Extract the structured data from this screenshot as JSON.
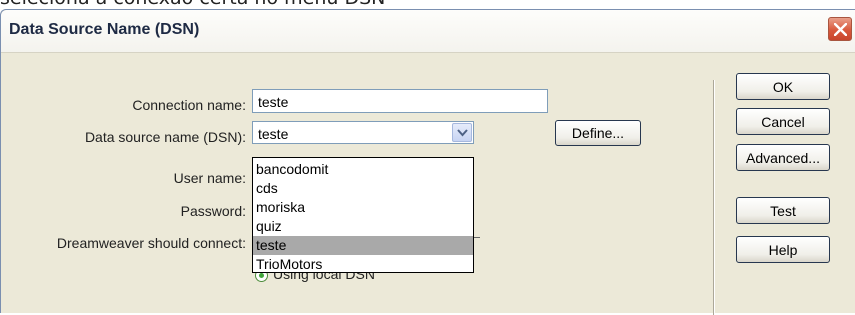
{
  "background_caption": "seleciona a conexão certa no menu DSN",
  "window": {
    "title": "Data Source Name (DSN)"
  },
  "form": {
    "connection_name_label": "Connection name:",
    "connection_name_value": "teste",
    "dsn_label": "Data source name (DSN):",
    "dsn_value": "teste",
    "user_name_label": "User name:",
    "password_label": "Password:",
    "connect_label": "Dreamweaver should connect:",
    "radio_local_label": "Using local DSN"
  },
  "dsn_dropdown": {
    "options": [
      "bancodomit",
      "cds",
      "moriska",
      "quiz",
      "teste",
      "TrioMotors"
    ],
    "selected": "teste"
  },
  "buttons": {
    "define": "Define...",
    "ok": "OK",
    "cancel": "Cancel",
    "advanced": "Advanced...",
    "test": "Test",
    "help": "Help"
  },
  "colors": {
    "dialog_bg": "#ece9d8",
    "selection_bg": "#a9a9a9",
    "close_button": "#d9583c"
  }
}
